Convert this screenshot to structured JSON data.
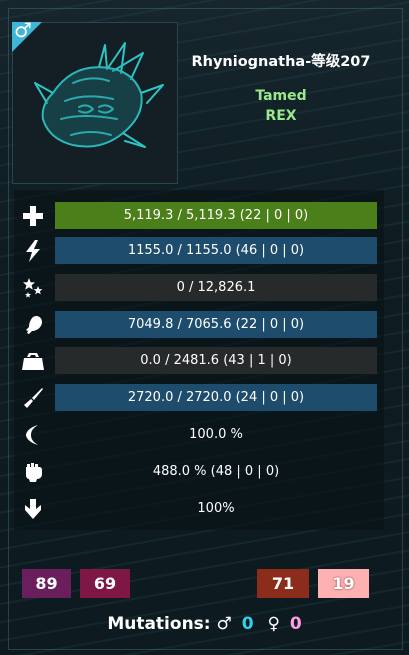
{
  "creature": {
    "name": "Rhyniognatha-等级207",
    "status": "Tamed",
    "owner": "REX",
    "gender_icon": "male-icon"
  },
  "stats": [
    {
      "icon": "health-cross-icon",
      "text": "5,119.3 / 5,119.3  (22 | 0 | 0)",
      "style": "health"
    },
    {
      "icon": "stamina-lightning-icon",
      "text": "1155.0 / 1155.0  (46 | 0 | 0)",
      "style": "blue"
    },
    {
      "icon": "torpidity-stars-icon",
      "text": "0 / 12,826.1",
      "style": "dark"
    },
    {
      "icon": "food-drumstick-icon",
      "text": "7049.8 / 7065.6  (22 | 0 | 0)",
      "style": "blue"
    },
    {
      "icon": "weight-icon",
      "text": "0.0 / 2481.6  (43 | 1 | 0)",
      "style": "dark"
    },
    {
      "icon": "melee-icon",
      "text": "2720.0 / 2720.0  (24 | 0 | 0)",
      "style": "blue"
    },
    {
      "icon": "speed-icon",
      "text": "100.0 %",
      "style": "none"
    },
    {
      "icon": "melee-fist-icon",
      "text": "488.0 %  (48 | 0 | 0)",
      "style": "none"
    },
    {
      "icon": "imprint-arrow-icon",
      "text": "100%",
      "style": "none"
    }
  ],
  "counters": [
    {
      "value": "89",
      "color": "#6a1e5c"
    },
    {
      "value": "69",
      "color": "#7e1745"
    },
    {
      "value": "71",
      "color": "#8c2c1a"
    },
    {
      "value": "19",
      "color": "#ffb1b1"
    }
  ],
  "mutations": {
    "label": "Mutations:",
    "male_symbol": "♂",
    "male_value": "0",
    "female_symbol": "♀",
    "female_value": "0"
  }
}
